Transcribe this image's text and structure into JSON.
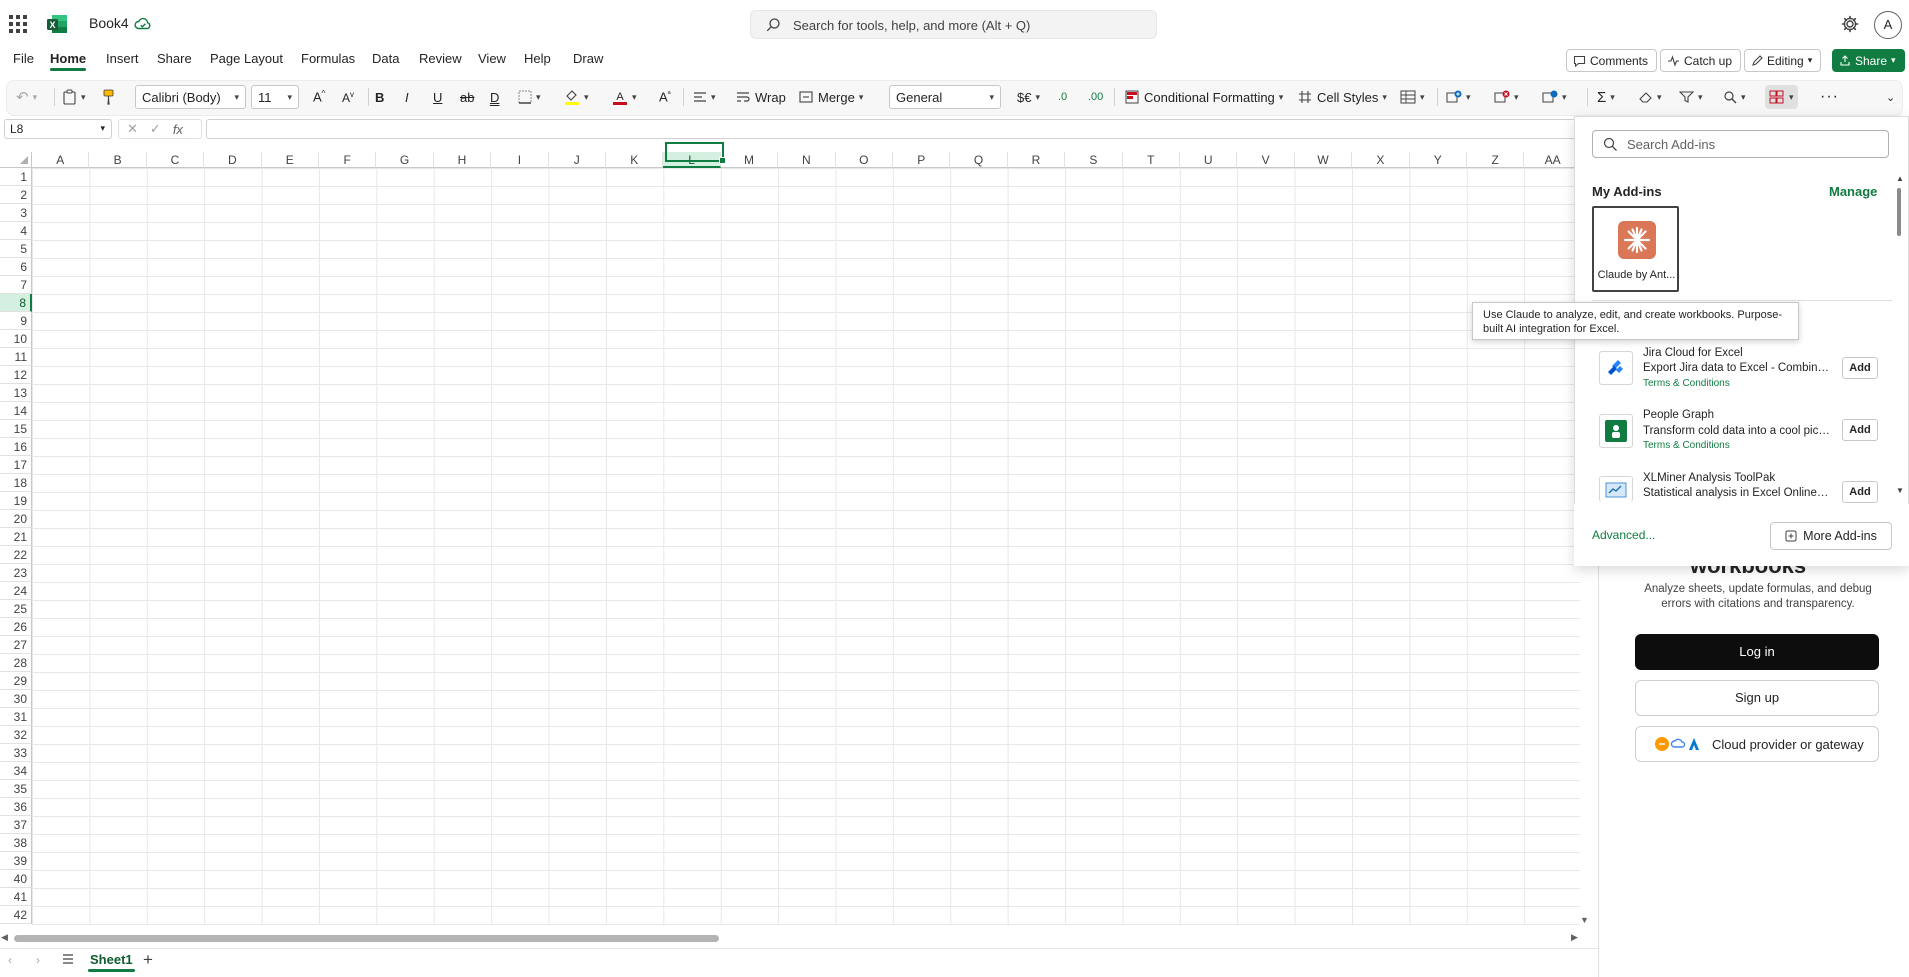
{
  "titlebar": {
    "doc_name": "Book4",
    "search_placeholder": "Search for tools, help, and more (Alt + Q)",
    "avatar_initial": "A"
  },
  "menu": {
    "tabs": [
      "File",
      "Home",
      "Insert",
      "Share",
      "Page Layout",
      "Formulas",
      "Data",
      "Review",
      "View",
      "Help",
      "Draw"
    ],
    "active_tab": "Home",
    "comments_label": "Comments",
    "catchup_label": "Catch up",
    "editing_label": "Editing",
    "share_label": "Share"
  },
  "ribbon": {
    "font_name": "Calibri (Body)",
    "font_size": "11",
    "wrap_label": "Wrap",
    "merge_label": "Merge",
    "number_format": "General",
    "currency_label": "$€",
    "conditional_formatting_label": "Conditional Formatting",
    "cell_styles_label": "Cell Styles",
    "more_label": "···"
  },
  "formula_bar": {
    "name_box": "L8",
    "fx_label": "fx",
    "formula_value": ""
  },
  "grid": {
    "columns": [
      "A",
      "B",
      "C",
      "D",
      "E",
      "F",
      "G",
      "H",
      "I",
      "J",
      "K",
      "L",
      "M",
      "N",
      "O",
      "P",
      "Q",
      "R",
      "S",
      "T",
      "U",
      "V",
      "W",
      "X",
      "Y",
      "Z",
      "AA"
    ],
    "row_count": 42,
    "selected_column": "L",
    "selected_row": 8
  },
  "sheets": {
    "tabs": [
      "Sheet1"
    ],
    "active": "Sheet1"
  },
  "addins_popup": {
    "search_placeholder": "Search Add-ins",
    "my_addins_label": "My Add-ins",
    "manage_label": "Manage",
    "claude_tile_label": "Claude by Ant...",
    "tooltip": "Use Claude to analyze, edit, and create workbooks. Purpose-built AI integration for Excel.",
    "items": [
      {
        "title": "Jira Cloud for Excel",
        "description": "Export Jira data to Excel - Combine t...",
        "terms": "Terms & Conditions",
        "add_label": "Add"
      },
      {
        "title": "People Graph",
        "description": "Transform cold data into a cool picture.",
        "terms": "Terms & Conditions",
        "add_label": "Add"
      },
      {
        "title": "XLMiner Analysis ToolPak",
        "description": "Statistical analysis in Excel Online, w...",
        "terms": "",
        "add_label": "Add"
      }
    ],
    "advanced_label": "Advanced...",
    "more_addins_label": "More Add-ins"
  },
  "task_pane": {
    "heading_fragment": "workbooks",
    "description": "Analyze sheets, update formulas, and debug errors with citations and transparency.",
    "login_label": "Log in",
    "signup_label": "Sign up",
    "cloud_label": "Cloud provider or gateway"
  },
  "colors": {
    "excel_green": "#107c41",
    "claude_orange": "#d97757",
    "selection_fill": "#d3f0e0"
  }
}
